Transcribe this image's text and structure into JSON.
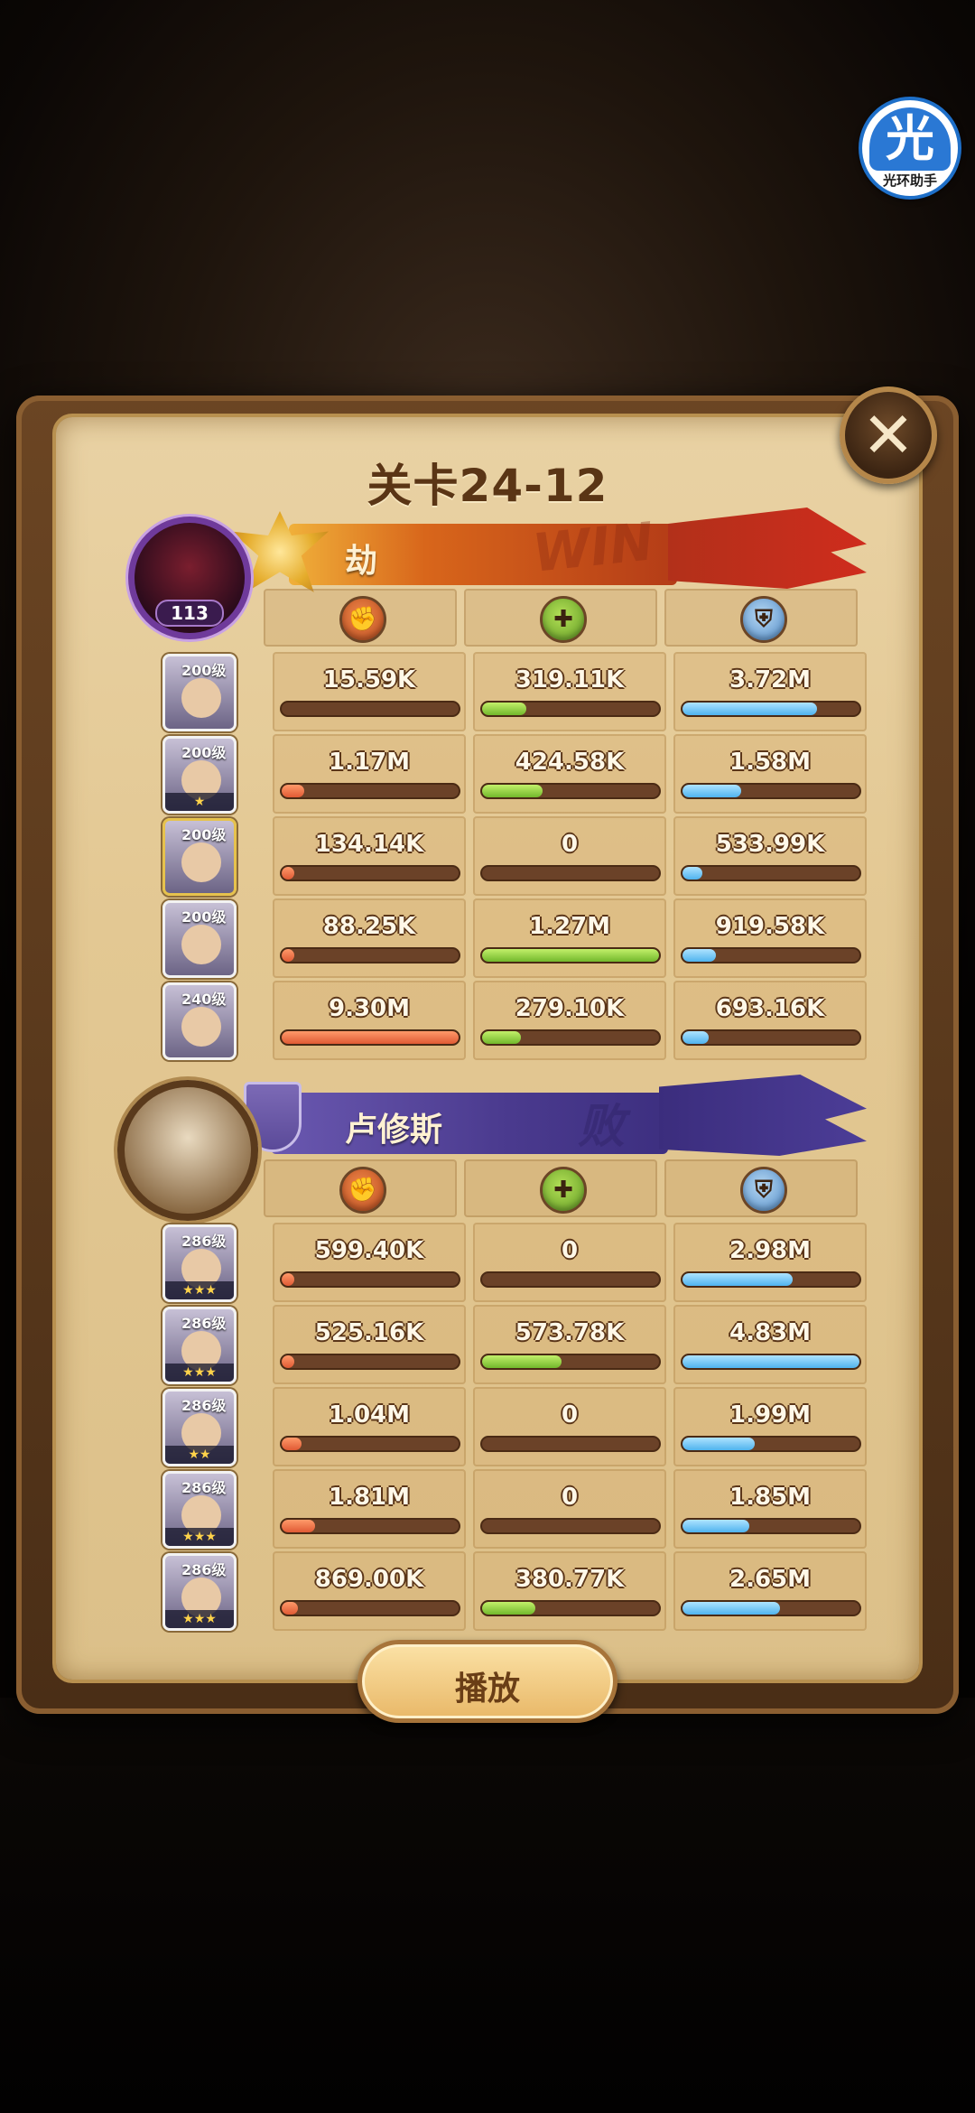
{
  "overlay_app": {
    "badge_char": "光",
    "label": "光环助手"
  },
  "dialog": {
    "title": "关卡24-12",
    "close_icon": "close-icon",
    "play_label": "播放"
  },
  "colors": {
    "win_banner": "#d8661b",
    "lose_banner": "#4a3a8e",
    "damage": "#e05a34",
    "healing": "#72b82c",
    "shield": "#4fb3ee"
  },
  "stat_icons": [
    "damage-icon",
    "healing-icon",
    "shield-icon"
  ],
  "attacker": {
    "name": "劫",
    "level": "113",
    "result": "WIN",
    "heroes": [
      {
        "level": "200级",
        "stars": "",
        "damage": "15.59K",
        "healing": "319.11K",
        "shield": "3.72M",
        "damage_frac": 0.0,
        "healing_frac": 0.25,
        "shield_frac": 0.76
      },
      {
        "level": "200级",
        "stars": "★",
        "damage": "1.17M",
        "healing": "424.58K",
        "shield": "1.58M",
        "damage_frac": 0.13,
        "healing_frac": 0.34,
        "shield_frac": 0.33
      },
      {
        "level": "200级",
        "stars": "",
        "damage": "134.14K",
        "healing": "0",
        "shield": "533.99K",
        "damage_frac": 0.02,
        "healing_frac": 0.0,
        "shield_frac": 0.11
      },
      {
        "level": "200级",
        "stars": "",
        "damage": "88.25K",
        "healing": "1.27M",
        "shield": "919.58K",
        "damage_frac": 0.01,
        "healing_frac": 1.0,
        "shield_frac": 0.19
      },
      {
        "level": "240级",
        "stars": "",
        "damage": "9.30M",
        "healing": "279.10K",
        "shield": "693.16K",
        "damage_frac": 1.0,
        "healing_frac": 0.22,
        "shield_frac": 0.15
      }
    ]
  },
  "defender": {
    "name": "卢修斯",
    "result": "败",
    "heroes": [
      {
        "level": "286级",
        "stars": "★★★",
        "damage": "599.40K",
        "healing": "0",
        "shield": "2.98M",
        "damage_frac": 0.07,
        "healing_frac": 0.0,
        "shield_frac": 0.62
      },
      {
        "level": "286级",
        "stars": "★★★",
        "damage": "525.16K",
        "healing": "573.78K",
        "shield": "4.83M",
        "damage_frac": 0.06,
        "healing_frac": 0.45,
        "shield_frac": 1.0
      },
      {
        "level": "286级",
        "stars": "★★",
        "damage": "1.04M",
        "healing": "0",
        "shield": "1.99M",
        "damage_frac": 0.11,
        "healing_frac": 0.0,
        "shield_frac": 0.41
      },
      {
        "level": "286级",
        "stars": "★★★",
        "damage": "1.81M",
        "healing": "0",
        "shield": "1.85M",
        "damage_frac": 0.19,
        "healing_frac": 0.0,
        "shield_frac": 0.38
      },
      {
        "level": "286级",
        "stars": "★★★",
        "damage": "869.00K",
        "healing": "380.77K",
        "shield": "2.65M",
        "damage_frac": 0.09,
        "healing_frac": 0.3,
        "shield_frac": 0.55
      }
    ]
  }
}
